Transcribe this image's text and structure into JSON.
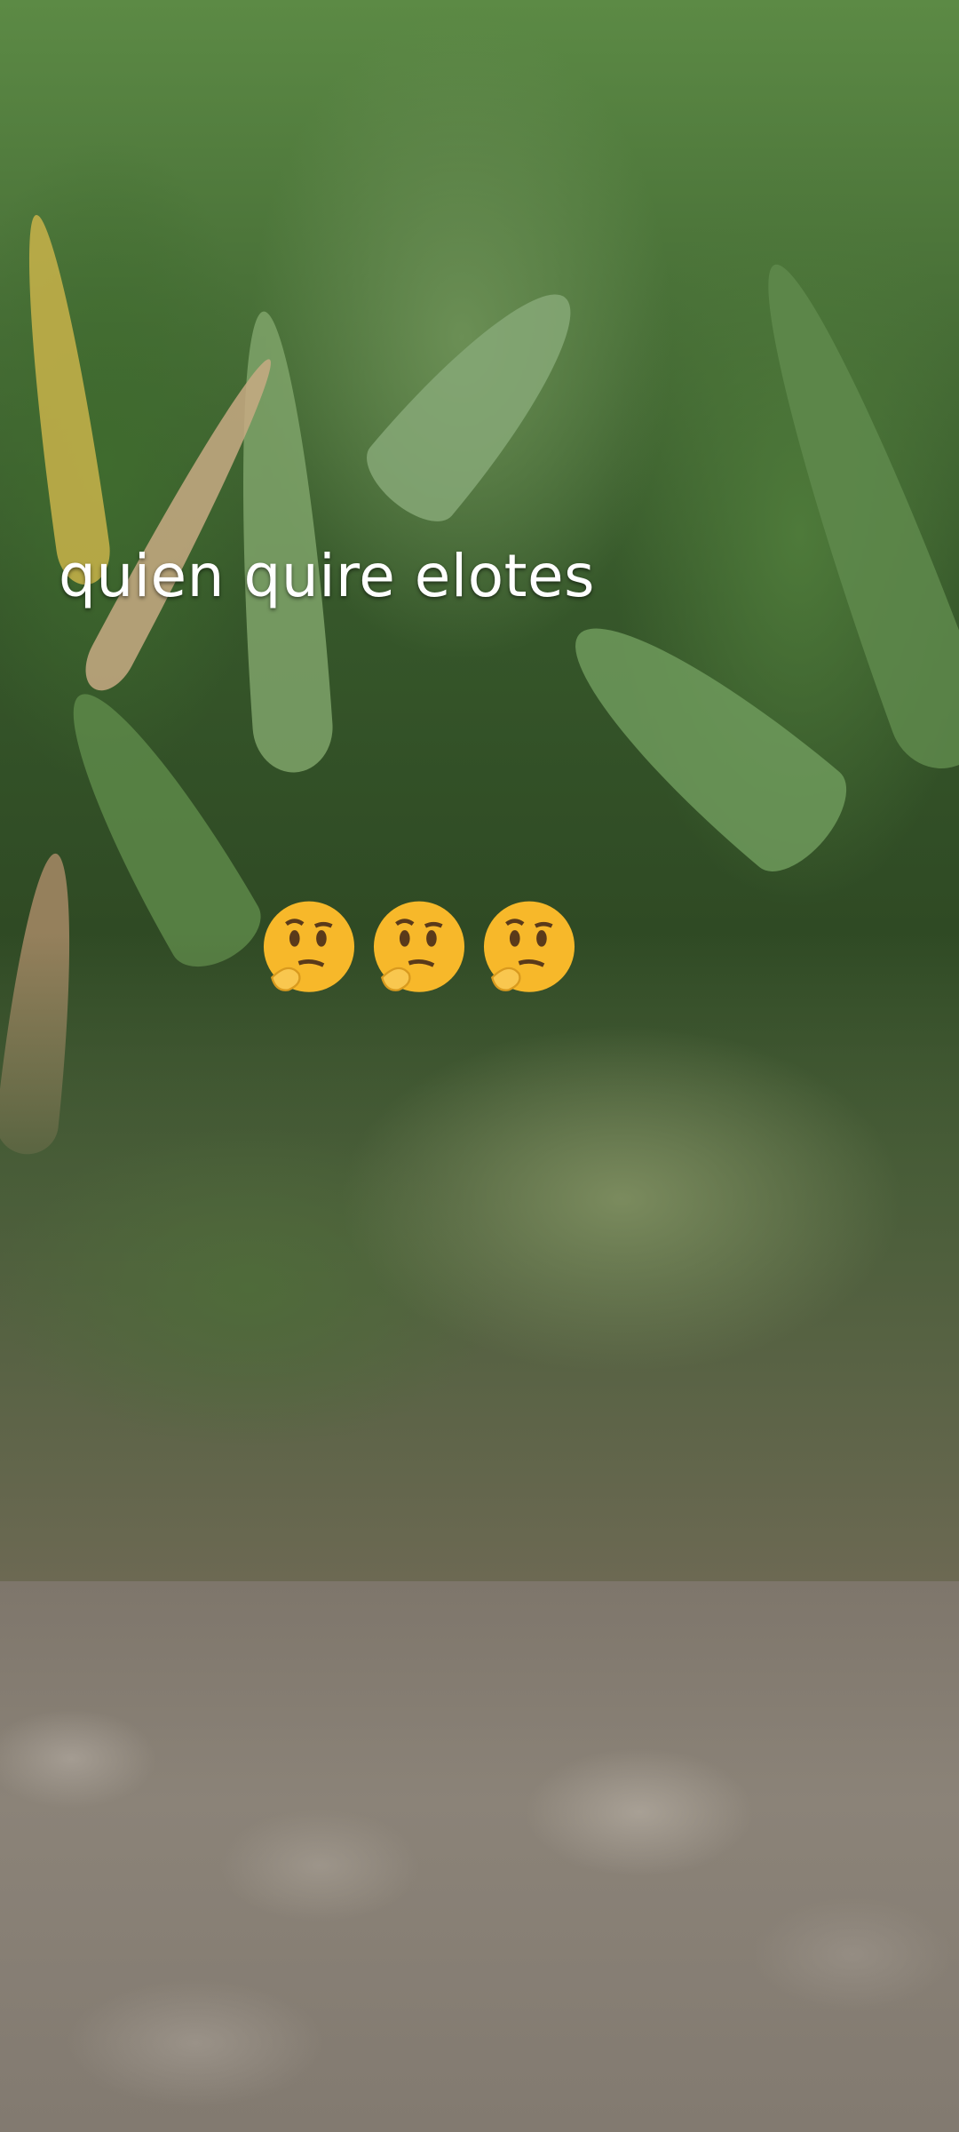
{
  "caption": {
    "text": "quien quire elotes"
  },
  "emojis": [
    {
      "icon": "thinking-face-icon"
    },
    {
      "icon": "thinking-face-icon"
    },
    {
      "icon": "thinking-face-icon"
    }
  ],
  "colors": {
    "caption_text": "#ffffff",
    "emoji_face": "#f7b82a"
  }
}
